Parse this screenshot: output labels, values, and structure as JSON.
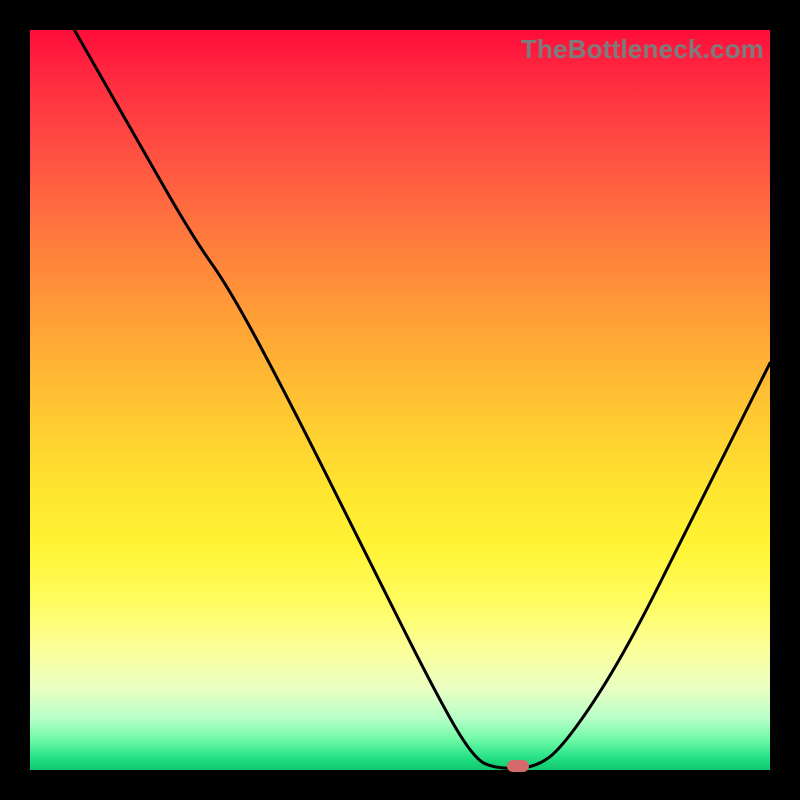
{
  "watermark": "TheBottleneck.com",
  "chart_data": {
    "type": "line",
    "title": "",
    "xlabel": "",
    "ylabel": "",
    "xlim": [
      0,
      100
    ],
    "ylim": [
      0,
      100
    ],
    "grid": false,
    "legend": false,
    "curve_points": [
      {
        "x": 6,
        "y": 100
      },
      {
        "x": 14,
        "y": 86
      },
      {
        "x": 22,
        "y": 72
      },
      {
        "x": 27,
        "y": 65
      },
      {
        "x": 35,
        "y": 50
      },
      {
        "x": 45,
        "y": 30
      },
      {
        "x": 55,
        "y": 10
      },
      {
        "x": 60,
        "y": 1.5
      },
      {
        "x": 63,
        "y": 0.2
      },
      {
        "x": 68,
        "y": 0.2
      },
      {
        "x": 72,
        "y": 3
      },
      {
        "x": 80,
        "y": 15
      },
      {
        "x": 90,
        "y": 35
      },
      {
        "x": 100,
        "y": 55
      }
    ],
    "marker": {
      "x": 66,
      "y": 0.5,
      "color": "#d46a6a"
    },
    "gradient_stops": [
      {
        "pos": 0,
        "color": "#ff0d3a"
      },
      {
        "pos": 25,
        "color": "#ff6f3f"
      },
      {
        "pos": 55,
        "color": "#ffd531"
      },
      {
        "pos": 80,
        "color": "#fdff80"
      },
      {
        "pos": 100,
        "color": "#14c96f"
      }
    ]
  }
}
